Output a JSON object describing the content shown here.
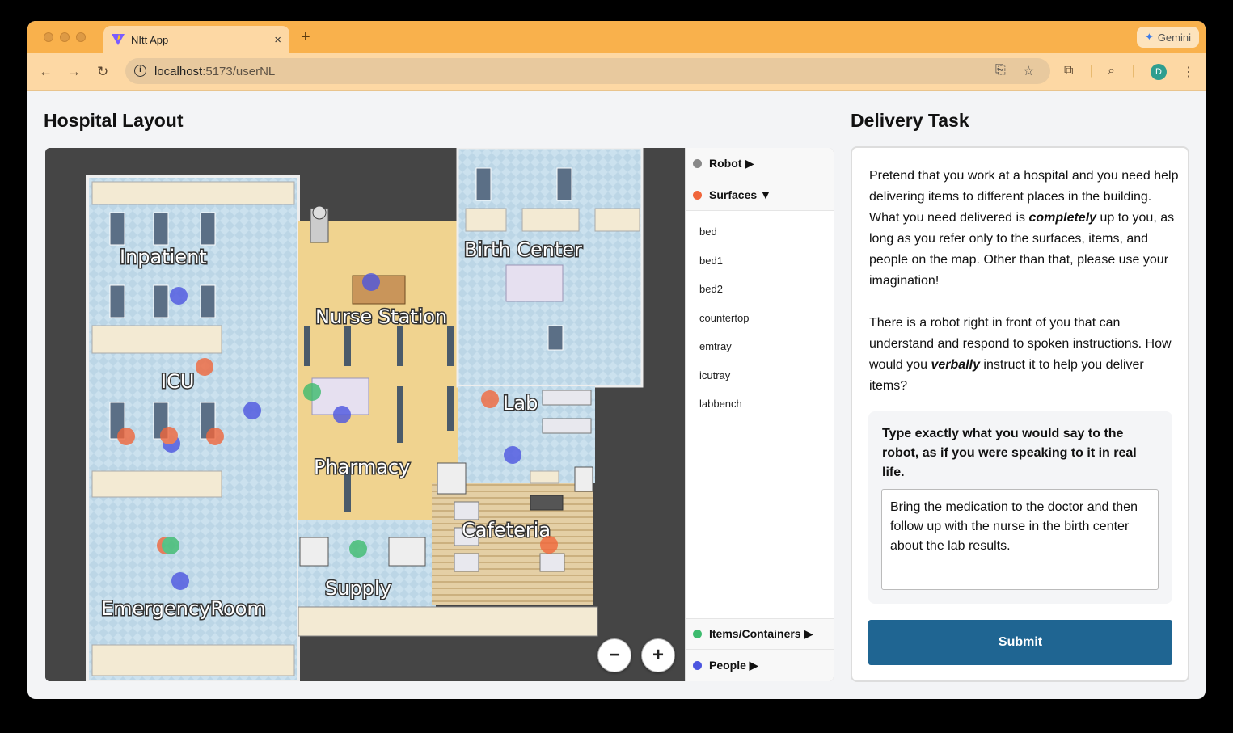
{
  "browser": {
    "tab_title": "NItt App",
    "tab_close": "×",
    "new_tab": "+",
    "gemini_label": "Gemini",
    "url_host": "localhost",
    "url_rest": ":5173/userNL",
    "avatar_letter": "D"
  },
  "left": {
    "heading": "Hospital Layout",
    "map_labels": {
      "inpatient": "Inpatient",
      "icu": "ICU",
      "emergency": "EmergencyRoom",
      "nurse_station": "Nurse Station",
      "pharmacy": "Pharmacy",
      "supply": "Supply",
      "birth_center": "Birth Center",
      "lab": "Lab",
      "cafeteria": "Cafeteria"
    },
    "zoom_out": "−",
    "zoom_in": "+"
  },
  "legend": {
    "robot": {
      "label": "Robot ▶",
      "color": "#888888"
    },
    "surfaces": {
      "label": "Surfaces ▼",
      "color": "#f0663b",
      "items": [
        "bed",
        "bed1",
        "bed2",
        "countertop",
        "emtray",
        "icutray",
        "labbench"
      ]
    },
    "items": {
      "label": "Items/Containers ▶",
      "color": "#3dbb6e"
    },
    "people": {
      "label": "People ▶",
      "color": "#4c55e0"
    }
  },
  "right": {
    "heading": "Delivery Task",
    "p1_a": "Pretend that you work at a hospital and you need help delivering items to different places in the building. What you need delivered is ",
    "p1_em": "completely",
    "p1_b": " up to you, as long as you refer only to the surfaces, items, and people on the map. Other than that, please use your imagination!",
    "p2_a": "There is a robot right in front of you that can understand and respond to spoken instructions. How would you ",
    "p2_em": "verbally",
    "p2_b": " instruct it to help you deliver items?",
    "prompt": "Type exactly what you would say to the robot, as if you were speaking to it in real life.",
    "answer": "Bring the medication to the doctor and then follow up with the nurse in the birth center about the lab results.",
    "submit": "Submit"
  }
}
